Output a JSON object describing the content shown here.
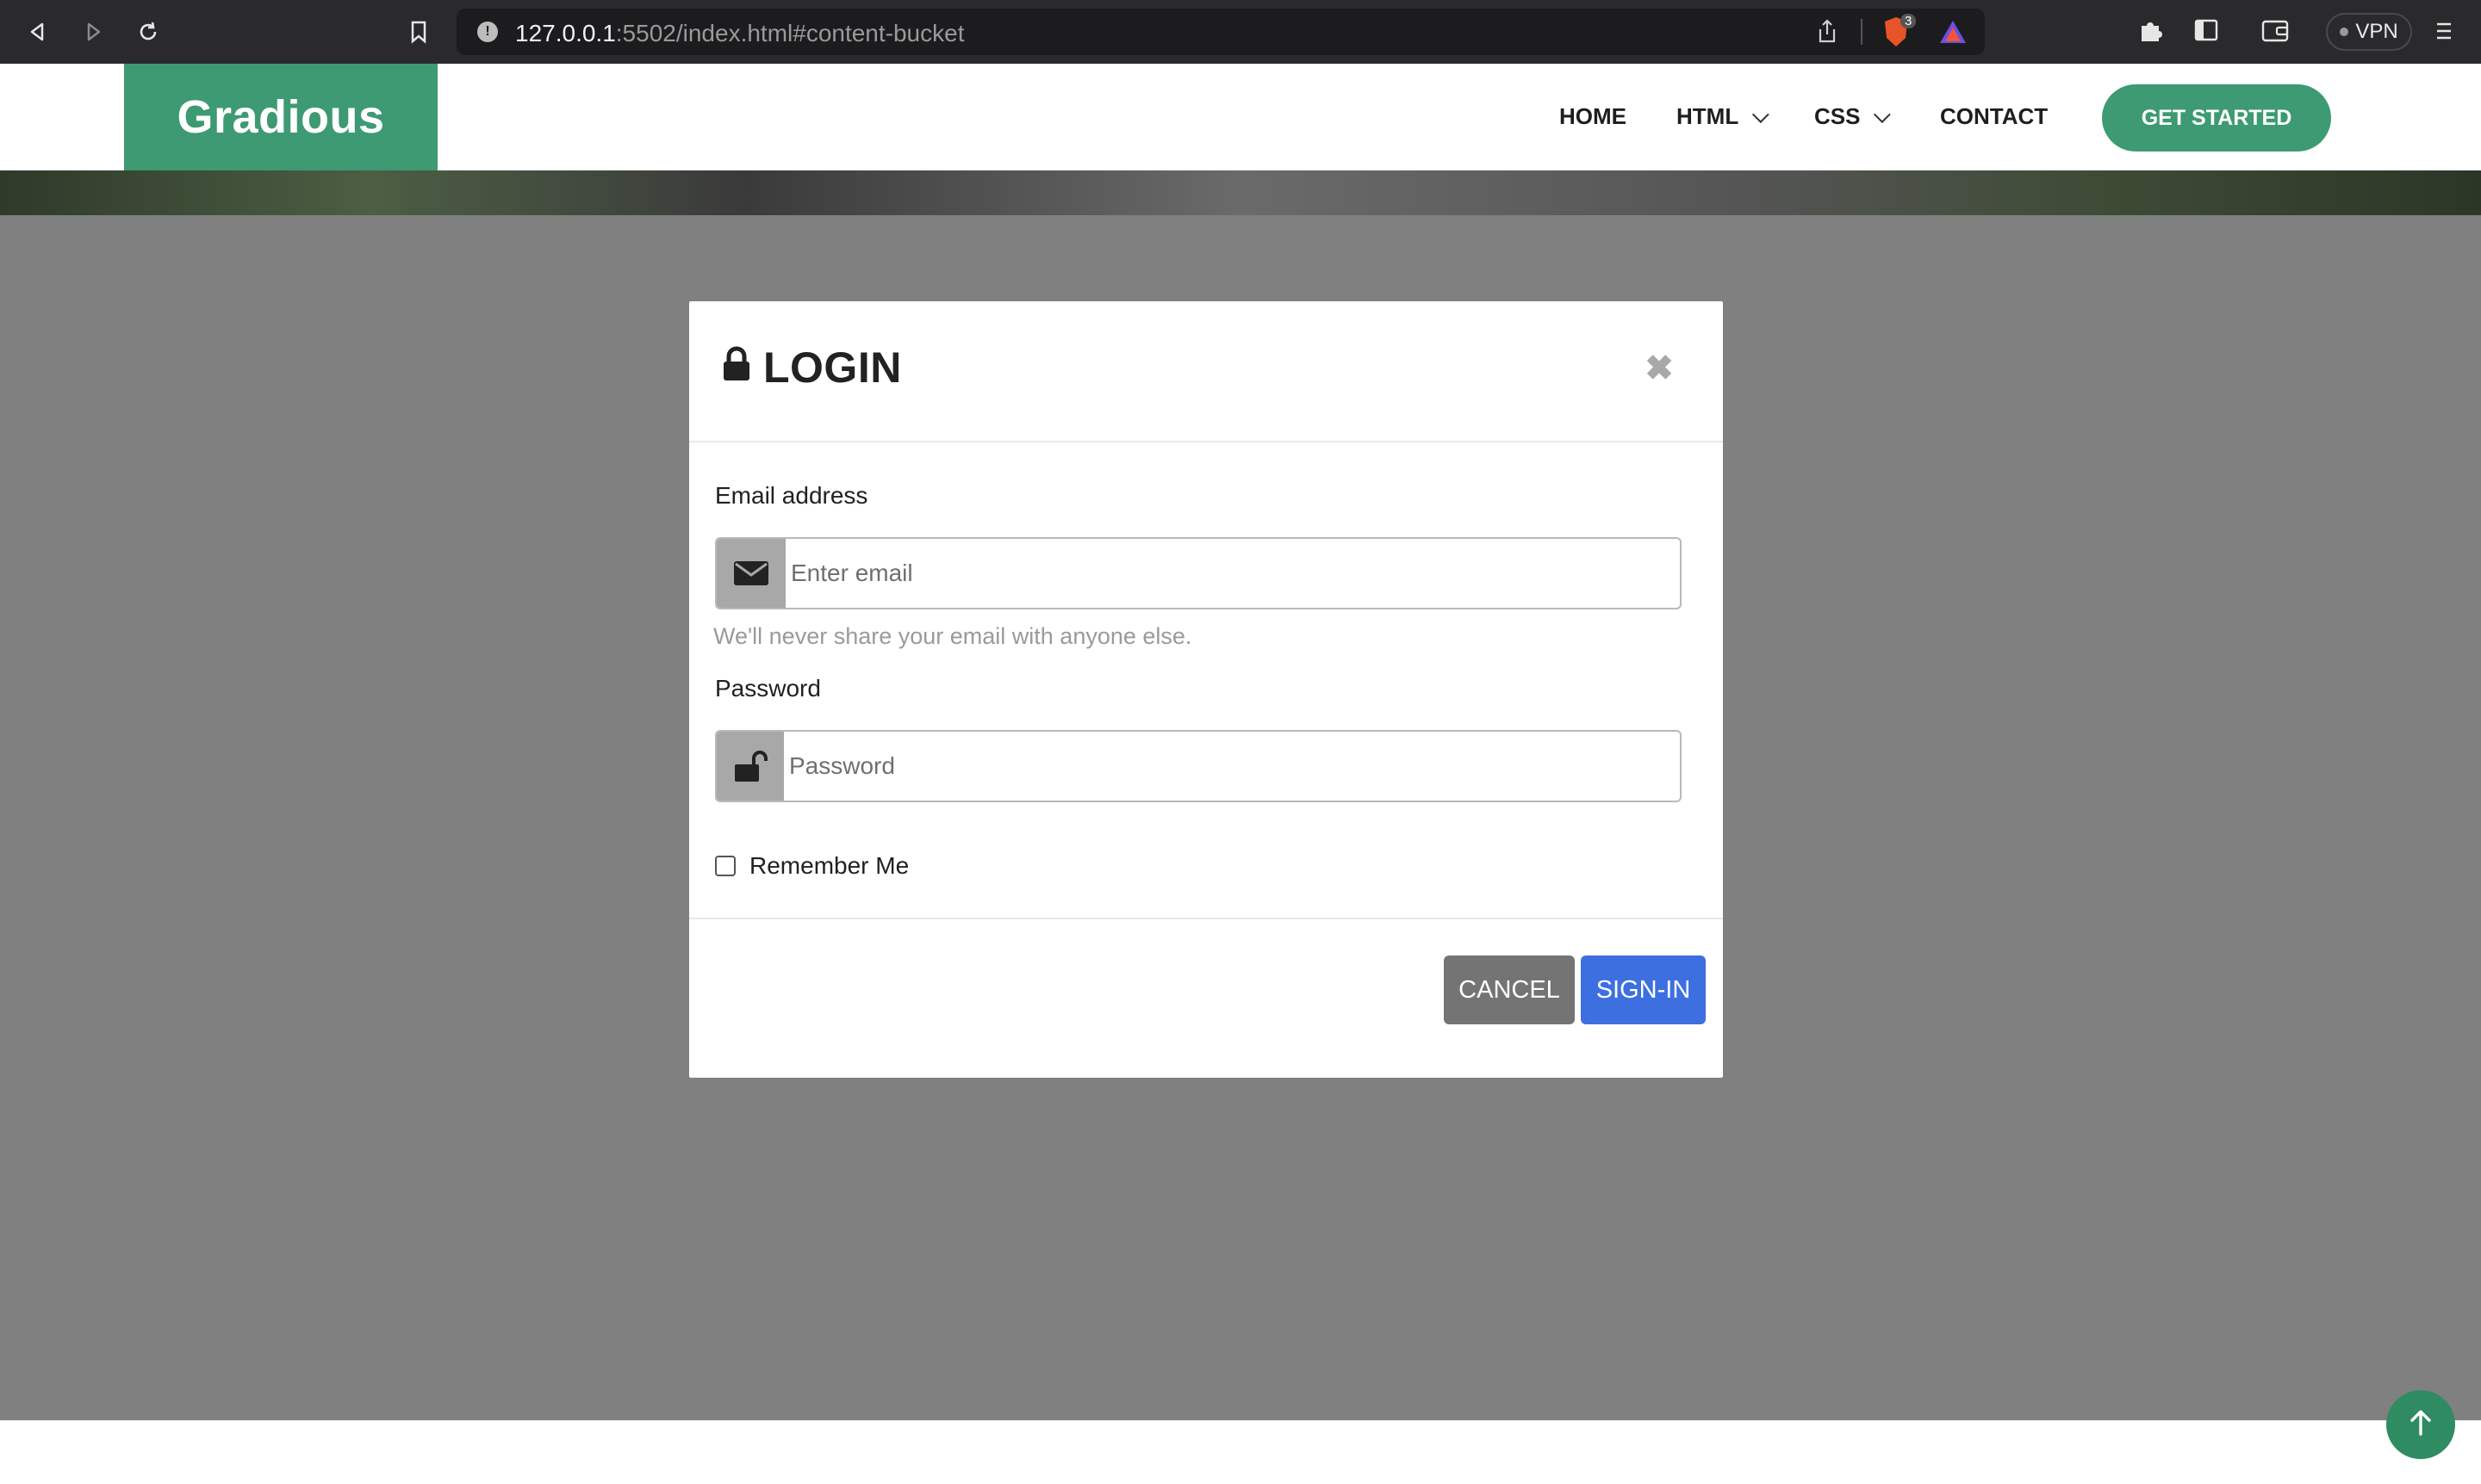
{
  "browser": {
    "url_host": "127.0.0.1",
    "url_path": ":5502/index.html#content-bucket",
    "brave_badge": "3",
    "vpn_label": "VPN"
  },
  "header": {
    "logo": "Gradious",
    "nav": [
      {
        "label": "HOME"
      },
      {
        "label": "HTML"
      },
      {
        "label": "CSS"
      },
      {
        "label": "CONTACT"
      }
    ],
    "cta_label": "GET STARTED"
  },
  "modal": {
    "title": "LOGIN",
    "email": {
      "label": "Email address",
      "placeholder": "Enter email",
      "help": "We'll never share your email with anyone else."
    },
    "password": {
      "label": "Password",
      "placeholder": "Password"
    },
    "remember_label": "Remember Me",
    "cancel_label": "CANCEL",
    "signin_label": "SIGN-IN"
  },
  "colors": {
    "brand_green": "#3d9a73",
    "primary_blue": "#3d6fe0",
    "overlay_gray": "#808080"
  }
}
